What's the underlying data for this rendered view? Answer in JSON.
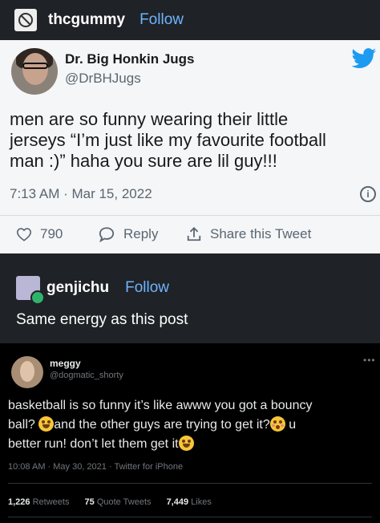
{
  "post": {
    "username": "thcgummy",
    "follow_label": "Follow"
  },
  "tweet": {
    "display_name": "Dr. Big Honkin Jugs",
    "handle": "@DrBHJugs",
    "lines": [
      "men are so funny wearing their little",
      "jerseys “I’m just like my favourite football",
      "man :)” haha you sure are lil guy!!!"
    ],
    "timestamp": "7:13 AM · Mar 15, 2022",
    "likes": "790",
    "reply_label": "Reply",
    "share_label": "Share this Tweet",
    "accent": "#1d9bf0"
  },
  "reblog": {
    "username": "genjichu",
    "follow_label": "Follow",
    "text": "Same energy as this post"
  },
  "tweet2": {
    "display_name": "meggy",
    "handle": "@dogmatic_shorty",
    "line1": "basketball is so funny it’s like awww you got a bouncy",
    "line2a": "ball?",
    "line2b": "and the other guys are trying to get it?",
    "line2c": "u",
    "line3": "better run! don’t let them get it",
    "meta": "10:08 AM · May 30, 2021 · Twitter for iPhone",
    "retweets_count": "1,226",
    "retweets_label": "Retweets",
    "quotes_count": "75",
    "quotes_label": "Quote Tweets",
    "likes_count": "7,449",
    "likes_label": "Likes"
  }
}
